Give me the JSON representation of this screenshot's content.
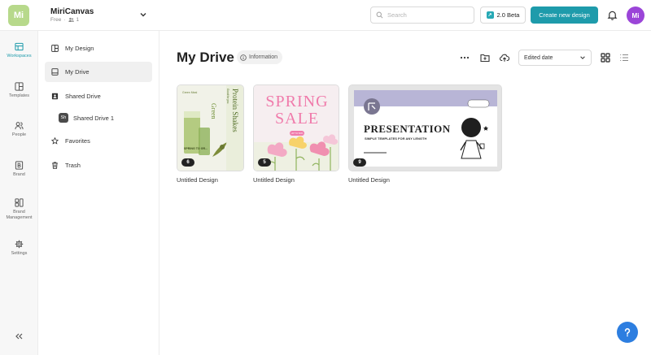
{
  "topbar": {
    "workspace_initials": "Mi",
    "workspace_name": "MiriCanvas",
    "plan": "Free",
    "member_count": "1",
    "search_placeholder": "Search",
    "beta_label": "2.0 Beta",
    "create_label": "Create new design",
    "user_initials": "Mi"
  },
  "rail": {
    "items": [
      {
        "label": "Workspaces",
        "icon": "workspaces-icon"
      },
      {
        "label": "Templates",
        "icon": "templates-icon"
      },
      {
        "label": "People",
        "icon": "people-icon"
      },
      {
        "label": "Brand",
        "icon": "brand-icon"
      },
      {
        "label": "Brand Management",
        "icon": "brand-management-icon"
      },
      {
        "label": "Settings",
        "icon": "gear-icon"
      }
    ]
  },
  "panel": {
    "my_design": "My Design",
    "my_drive": "My Drive",
    "shared_drive": "Shared Drive",
    "shared_drive_1_badge": "Sh",
    "shared_drive_1": "Shared Drive 1",
    "favorites": "Favorites",
    "trash": "Trash"
  },
  "main": {
    "title": "My Drive",
    "info_label": "Information",
    "sort_label": "Edited date",
    "cards": [
      {
        "title": "Untitled Design",
        "count": "6",
        "thumb": {
          "brand": "Green Meal",
          "word": "Green",
          "vertical": "Protein Shakes",
          "sub": "Good for you",
          "caption": "SPRING TO GR..."
        }
      },
      {
        "title": "Untitled Design",
        "count": "5",
        "thumb": {
          "line1": "SPRING",
          "line2": "SALE",
          "badge": "UP TO 50%"
        }
      },
      {
        "title": "Untitled Design",
        "count": "9",
        "thumb": {
          "heading": "PRESENTATION",
          "sub": "SIMPLE TEMPLATES FOR ANY LENGTH"
        }
      }
    ]
  },
  "colors": {
    "accent": "#1e9bab",
    "avatar": "#9b45d8",
    "help": "#2d7ee0"
  }
}
